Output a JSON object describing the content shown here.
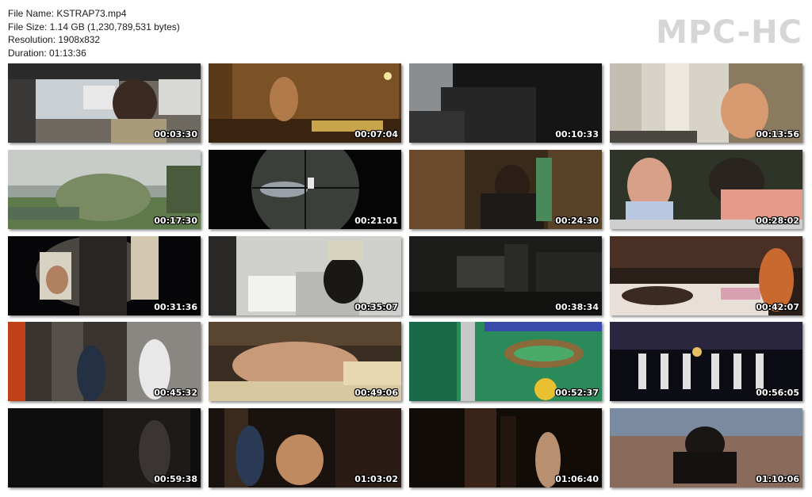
{
  "info": {
    "file_name": "File Name: KSTRAP73.mp4",
    "file_size": "File Size: 1.14 GB (1,230,789,531 bytes)",
    "resolution": "Resolution: 1908x832",
    "duration": "Duration: 01:13:36"
  },
  "logo": "MPC-HC",
  "thumbnails": [
    {
      "time": "00:03:30",
      "scene": "man-driving-car"
    },
    {
      "time": "00:07:04",
      "scene": "couple-in-wooden-room"
    },
    {
      "time": "00:10:33",
      "scene": "dark-corridor"
    },
    {
      "time": "00:13:56",
      "scene": "woman-in-kitchen"
    },
    {
      "time": "00:17:30",
      "scene": "train-and-grass"
    },
    {
      "time": "00:21:01",
      "scene": "rifle-scope-view"
    },
    {
      "time": "00:24:30",
      "scene": "man-in-suit-indoors"
    },
    {
      "time": "00:28:02",
      "scene": "couple-at-table"
    },
    {
      "time": "00:31:36",
      "scene": "view-through-opening"
    },
    {
      "time": "00:35:07",
      "scene": "bathroom-scene"
    },
    {
      "time": "00:38:34",
      "scene": "dim-hallway"
    },
    {
      "time": "00:42:07",
      "scene": "bedroom-scene"
    },
    {
      "time": "00:45:32",
      "scene": "shop-interior"
    },
    {
      "time": "00:49:06",
      "scene": "couple-on-bed"
    },
    {
      "time": "00:52:37",
      "scene": "pachinko-machine"
    },
    {
      "time": "00:56:05",
      "scene": "stage-performers"
    },
    {
      "time": "00:59:38",
      "scene": "dark-doorway"
    },
    {
      "time": "01:03:02",
      "scene": "two-men-at-night"
    },
    {
      "time": "01:06:40",
      "scene": "narrow-alley"
    },
    {
      "time": "01:10:06",
      "scene": "man-with-sunglasses"
    }
  ]
}
